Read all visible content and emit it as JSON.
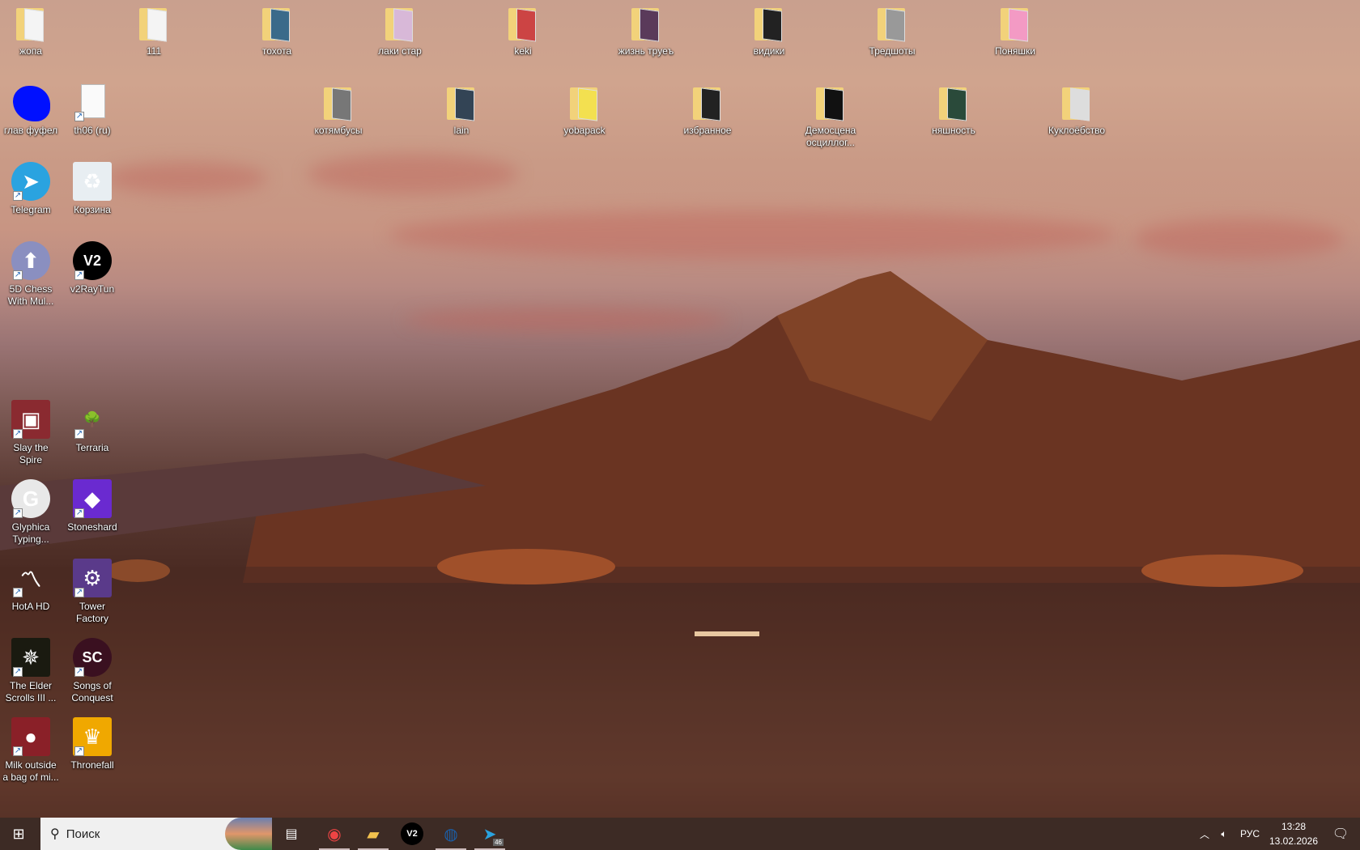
{
  "desktop": {
    "icons": [
      {
        "label": "жопа",
        "type": "folder",
        "col": 0,
        "row": 0,
        "color": "#f4f4f4"
      },
      {
        "label": "111",
        "type": "folder",
        "col": 2,
        "row": 0,
        "color": "#f4f4f4"
      },
      {
        "label": "тохота",
        "type": "folder",
        "col": 4,
        "row": 0,
        "color": "#3a6a8a"
      },
      {
        "label": "лаки стар",
        "type": "folder",
        "col": 6,
        "row": 0,
        "color": "#d8b8d8"
      },
      {
        "label": "keki",
        "type": "folder",
        "col": 8,
        "row": 0,
        "color": "#c44"
      },
      {
        "label": "жизнь труеъ",
        "type": "folder",
        "col": 10,
        "row": 0,
        "color": "#5a3a5a"
      },
      {
        "label": "видики",
        "type": "folder",
        "col": 12,
        "row": 0,
        "color": "#222"
      },
      {
        "label": "Тредшоты",
        "type": "folder",
        "col": 14,
        "row": 0,
        "color": "#999"
      },
      {
        "label": "Поняшки",
        "type": "folder",
        "col": 16,
        "row": 0,
        "color": "#f39ac4"
      },
      {
        "label": "глав фуфел",
        "type": "blob",
        "col": 0,
        "row": 1,
        "color": "#0010ff"
      },
      {
        "label": "th06 (ru)",
        "type": "file",
        "col": 1,
        "row": 1,
        "shortcut": true
      },
      {
        "label": "котямбусы",
        "type": "folder",
        "col": 5,
        "row": 1,
        "color": "#777"
      },
      {
        "label": "lain",
        "type": "folder",
        "col": 7,
        "row": 1,
        "color": "#345"
      },
      {
        "label": "yobapack",
        "type": "folder",
        "col": 9,
        "row": 1,
        "color": "#f3e050"
      },
      {
        "label": "избранное",
        "type": "folder",
        "col": 11,
        "row": 1,
        "color": "#222"
      },
      {
        "label": "Демосцена осциллог...",
        "type": "folder",
        "col": 13,
        "row": 1,
        "color": "#111"
      },
      {
        "label": "няшность",
        "type": "folder",
        "col": 15,
        "row": 1,
        "color": "#2a4a3a"
      },
      {
        "label": "Куклоёбство",
        "type": "folder",
        "col": 17,
        "row": 1,
        "color": "#ddd"
      },
      {
        "label": "Telegram",
        "type": "app",
        "col": 0,
        "row": 2,
        "color": "#2aa3e0",
        "glyph": "➤",
        "shortcut": true,
        "round": true
      },
      {
        "label": "Корзина",
        "type": "app",
        "col": 1,
        "row": 2,
        "color": "#e8eef2",
        "glyph": "♻",
        "round": false
      },
      {
        "label": "5D Chess With Mul...",
        "type": "app",
        "col": 0,
        "row": 3,
        "color": "#8a8fc0",
        "glyph": "⬆",
        "shortcut": true,
        "round": true
      },
      {
        "label": "v2RayTun",
        "type": "app",
        "col": 1,
        "row": 3,
        "color": "#000",
        "glyph": "V2",
        "shortcut": true,
        "round": true
      },
      {
        "label": "Slay the Spire",
        "type": "app",
        "col": 0,
        "row": 5,
        "color": "#8a2a30",
        "glyph": "▣",
        "shortcut": true
      },
      {
        "label": "Terraria",
        "type": "app",
        "col": 1,
        "row": 5,
        "color": "transparent",
        "glyph": "🌳",
        "shortcut": true
      },
      {
        "label": "Glyphica Typing...",
        "type": "app",
        "col": 0,
        "row": 6,
        "color": "#e8e8e8",
        "glyph": "G",
        "shortcut": true,
        "round": true
      },
      {
        "label": "Stoneshard",
        "type": "app",
        "col": 1,
        "row": 6,
        "color": "#6a2ad0",
        "glyph": "◆",
        "shortcut": true
      },
      {
        "label": "HotA HD",
        "type": "app",
        "col": 0,
        "row": 7,
        "color": "transparent",
        "glyph": "〽",
        "shortcut": true
      },
      {
        "label": "Tower Factory",
        "type": "app",
        "col": 1,
        "row": 7,
        "color": "#5a3a8a",
        "glyph": "⚙",
        "shortcut": true
      },
      {
        "label": "The Elder Scrolls III ...",
        "type": "app",
        "col": 0,
        "row": 8,
        "color": "#1a1a10",
        "glyph": "✵",
        "shortcut": true
      },
      {
        "label": "Songs of Conquest",
        "type": "app",
        "col": 1,
        "row": 8,
        "color": "#3a1020",
        "glyph": "SC",
        "shortcut": true,
        "round": true
      },
      {
        "label": "Milk outside a bag of mi...",
        "type": "app",
        "col": 0,
        "row": 9,
        "color": "#8a2028",
        "glyph": "●",
        "shortcut": true
      },
      {
        "label": "Thronefall",
        "type": "app",
        "col": 1,
        "row": 9,
        "color": "#f0a800",
        "glyph": "♛",
        "shortcut": true
      }
    ]
  },
  "taskbar": {
    "search_placeholder": "Поиск",
    "apps": [
      {
        "name": "chrome",
        "glyph": "◉",
        "color": "#e44",
        "open": true
      },
      {
        "name": "file-explorer",
        "glyph": "▰",
        "color": "#f2c14e",
        "open": true
      },
      {
        "name": "v2raytun",
        "glyph": "V2",
        "color": "#fff",
        "open": false
      },
      {
        "name": "steam",
        "glyph": "◍",
        "color": "#1b5fa8",
        "open": true
      },
      {
        "name": "telegram",
        "glyph": "➤",
        "color": "#2aa3e0",
        "open": true,
        "badge": "46"
      }
    ],
    "tray": {
      "language": "РУС",
      "time": "13:28",
      "date": "13.02.2026"
    }
  }
}
